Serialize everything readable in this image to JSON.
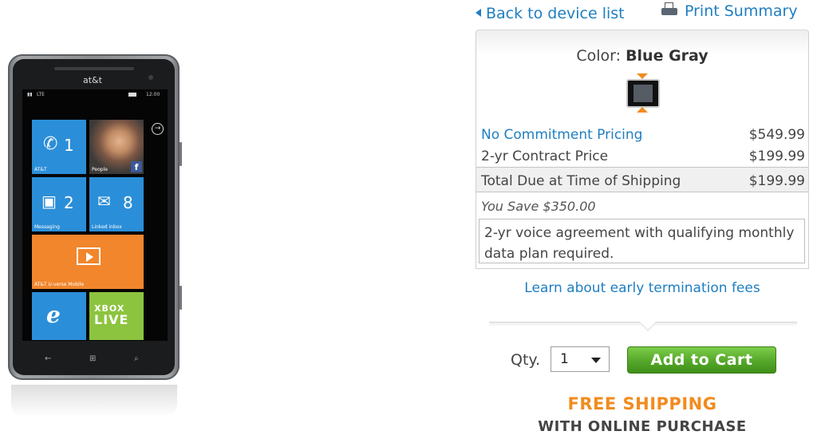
{
  "phone": {
    "carrier_logo": "at&t",
    "status_time": "12:00",
    "status_network": "LTE",
    "tiles": {
      "att_label": "AT&T",
      "att_count": "1",
      "people_label": "People",
      "messaging_label": "Messaging",
      "messaging_count": "2",
      "linked_inbox_label": "Linked inbox",
      "linked_inbox_count": "8",
      "uverse_label": "AT&T U-verse Mobile",
      "xbox_line1": "XBOX",
      "xbox_line2": "LIVE"
    }
  },
  "nav": {
    "back_label": "Back to device list",
    "print_label": "Print Summary"
  },
  "color": {
    "label": "Color:",
    "value": "Blue Gray",
    "swatch_hex": "#555c63"
  },
  "pricing": {
    "no_commitment_label": "No Commitment Pricing",
    "no_commitment_price": "$549.99",
    "contract_label": "2-yr Contract Price",
    "contract_price": "$199.99",
    "total_label": "Total Due at Time of Shipping",
    "total_price": "$199.99",
    "savings": "You Save $350.00",
    "agreement_note": "2-yr voice agreement with qualifying monthly data plan required."
  },
  "links": {
    "learn_etf": "Learn about early termination fees"
  },
  "cart": {
    "qty_label": "Qty.",
    "qty_value": "1",
    "add_label": "Add to Cart"
  },
  "shipping": {
    "headline": "FREE SHIPPING",
    "subline": "WITH ONLINE PURCHASE"
  },
  "colors": {
    "link_blue": "#1f7ec1",
    "accent_orange": "#f28b1e",
    "cart_green": "#55a82a"
  }
}
